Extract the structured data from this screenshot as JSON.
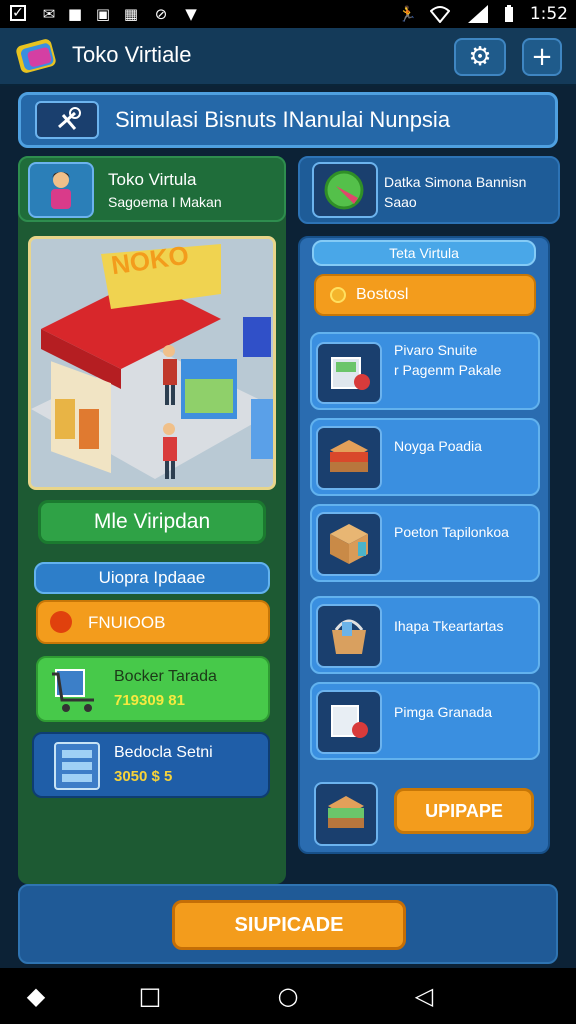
{
  "status_bar": {
    "time": "1:52"
  },
  "app_bar": {
    "title": "Toko Virtiale"
  },
  "banner": {
    "title": "Simulasi Bisnuts INanulai Nunpsia"
  },
  "left": {
    "profile": {
      "line1": "Toko Virtula",
      "line2": "Sagoema I Makan"
    },
    "store_illustration_sign": "NOKO",
    "main_button": "Mle Viripdan",
    "section_header": "Uiopra Ipdaae",
    "alert_label": "FNUIOOB",
    "stat1": {
      "label": "Bocker Tarada",
      "value": "719309 81"
    },
    "stat2": {
      "label": "Bedocla Setni",
      "value": "3050 $ 5"
    }
  },
  "right": {
    "top_card": {
      "line1": "Datka Simona Bannisn",
      "line2": "Saao"
    },
    "header": "Teta Virtula",
    "alert_label": "Bostosl",
    "items": [
      {
        "line1": "Pivaro Snuite",
        "line2": "r Pagenm Pakale"
      },
      {
        "line1": "Noyga Poadia",
        "line2": ""
      },
      {
        "line1": "Poeton Tapilonkoa",
        "line2": ""
      },
      {
        "line1": "Ihapa Tkeartartas",
        "line2": ""
      },
      {
        "line1": "Pimga Granada",
        "line2": ""
      }
    ],
    "update_button": "UPIPAPE"
  },
  "bottom": {
    "button": "SIUPICADE"
  },
  "colors": {
    "orange": "#f39c1c",
    "green": "#47c94a",
    "blue": "#2d7ec9",
    "dark_blue": "#143a59",
    "panel_green": "#1d5a33",
    "light_blue": "#49a7e8"
  }
}
